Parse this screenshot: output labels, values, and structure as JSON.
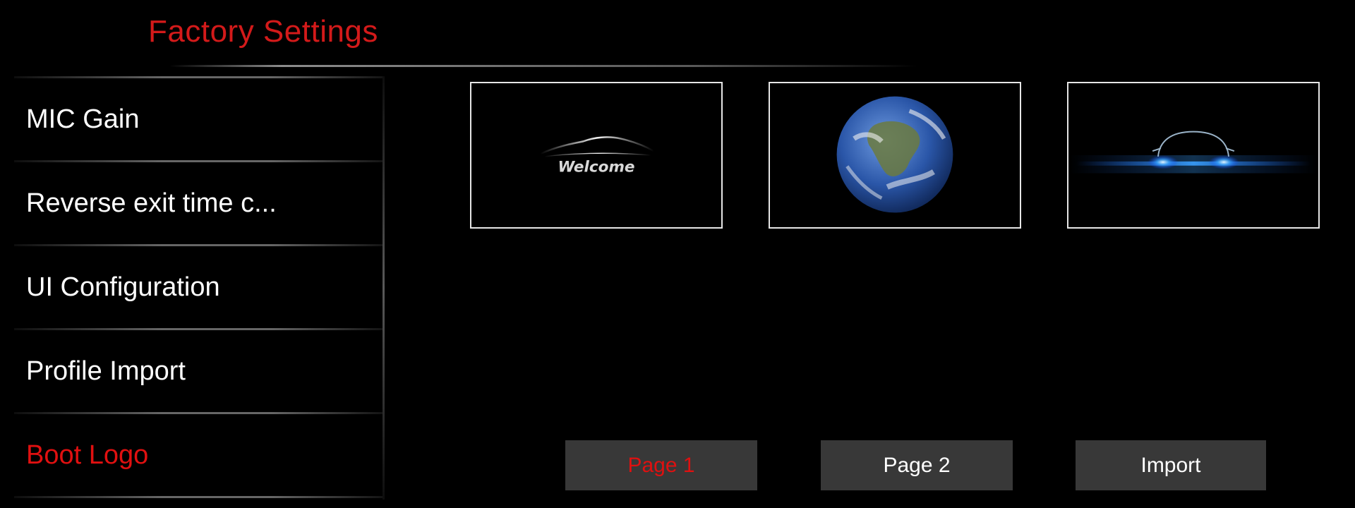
{
  "header": {
    "title": "Factory Settings"
  },
  "sidebar": {
    "items": [
      {
        "label": "MIC Gain"
      },
      {
        "label": "Reverse exit time c..."
      },
      {
        "label": "UI Configuration"
      },
      {
        "label": "Profile Import"
      },
      {
        "label": "Boot Logo"
      }
    ],
    "active_index": 4
  },
  "logos": [
    {
      "icon": "welcome-car-logo-icon",
      "text": "Welcome"
    },
    {
      "icon": "earth-globe-icon"
    },
    {
      "icon": "car-headlights-icon"
    }
  ],
  "footer": {
    "page1_label": "Page 1",
    "page2_label": "Page 2",
    "import_label": "Import",
    "active_page": 1
  },
  "colors": {
    "accent": "#e01010",
    "background": "#000000",
    "button_bg": "#383838"
  }
}
